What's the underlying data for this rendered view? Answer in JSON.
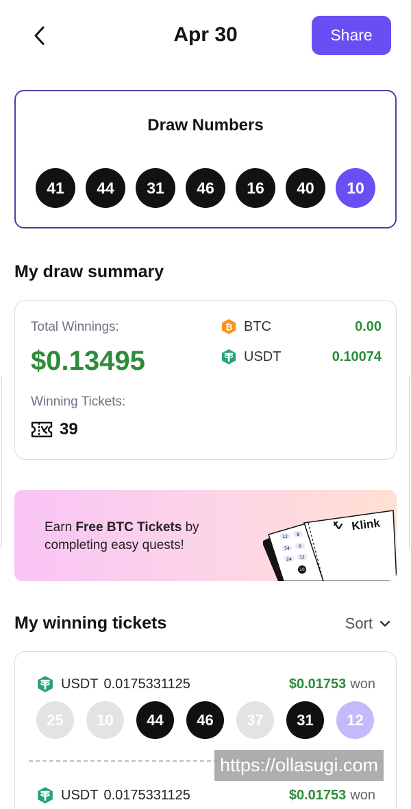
{
  "header": {
    "title": "Apr 30",
    "share_label": "Share"
  },
  "draw": {
    "title": "Draw Numbers",
    "numbers": [
      "41",
      "44",
      "31",
      "46",
      "16",
      "40"
    ],
    "bonus": "10"
  },
  "summary": {
    "section_title": "My draw summary",
    "total_label": "Total Winnings:",
    "total_value": "$0.13495",
    "tickets_label": "Winning Tickets:",
    "tickets_count": "39",
    "coins": [
      {
        "name": "BTC",
        "value": "0.00",
        "icon": "bitcoin-icon",
        "color": "#f7931a"
      },
      {
        "name": "USDT",
        "value": "0.10074",
        "icon": "tether-icon",
        "color": "#26a17b"
      }
    ]
  },
  "promo": {
    "text_before": "Earn ",
    "text_bold": "Free BTC Tickets",
    "text_after": " by completing easy quests!",
    "brand": "Klink",
    "ticket_numbers": [
      "12",
      "8",
      "54",
      "6",
      "24",
      "12",
      "10"
    ]
  },
  "winning": {
    "section_title": "My winning tickets",
    "sort_label": "Sort",
    "tickets": [
      {
        "currency": "USDT",
        "amount": "0.0175331125",
        "won_usd": "$0.01753",
        "won_word": "won",
        "numbers": [
          {
            "n": "25",
            "state": "miss"
          },
          {
            "n": "10",
            "state": "miss"
          },
          {
            "n": "44",
            "state": "hit"
          },
          {
            "n": "46",
            "state": "hit"
          },
          {
            "n": "37",
            "state": "miss"
          },
          {
            "n": "31",
            "state": "hit"
          },
          {
            "n": "12",
            "state": "bonus-miss"
          }
        ]
      },
      {
        "currency": "USDT",
        "amount": "0.0175331125",
        "won_usd": "$0.01753",
        "won_word": "won"
      }
    ]
  },
  "watermark": "https://ollasugi.com",
  "colors": {
    "accent": "#6b4ef3",
    "win_green": "#2e8b3a",
    "usdt": "#26a17b",
    "btc": "#f7931a"
  }
}
